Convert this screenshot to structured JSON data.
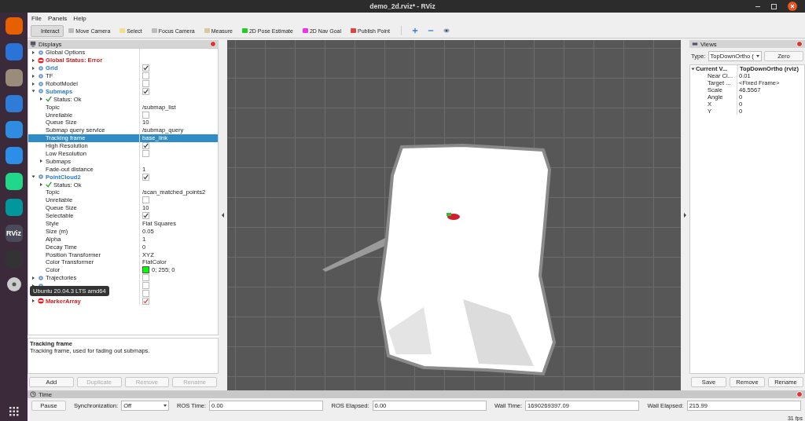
{
  "window": {
    "title": "demo_2d.rviz* - RViz"
  },
  "dock": {
    "logo_text": "RViz"
  },
  "menu": [
    "File",
    "Panels",
    "Help"
  ],
  "tools": [
    {
      "label": "Interact",
      "selected": true
    },
    {
      "label": "Move Camera",
      "selected": false
    },
    {
      "label": "Select",
      "selected": false
    },
    {
      "label": "Focus Camera",
      "selected": false
    },
    {
      "label": "Measure",
      "selected": false
    },
    {
      "label": "2D Pose Estimate",
      "selected": false
    },
    {
      "label": "2D Nav Goal",
      "selected": false
    },
    {
      "label": "Publish Point",
      "selected": false
    }
  ],
  "displays": {
    "title": "Displays",
    "items": [
      {
        "kind": "plain",
        "label": "Global Options",
        "expanded": false,
        "selected": false
      },
      {
        "kind": "error",
        "label": "Global Status: Error",
        "expanded": false,
        "selected": false
      },
      {
        "kind": "display",
        "label": "Grid",
        "checked": true,
        "expanded": false,
        "selected": false
      },
      {
        "kind": "display",
        "label": "TF",
        "checked": false,
        "expanded": false,
        "selected": false
      },
      {
        "kind": "display",
        "label": "RobotModel",
        "checked": false,
        "expanded": false,
        "selected": false
      },
      {
        "kind": "display",
        "label": "Submaps",
        "checked": true,
        "expanded": true,
        "selected": false,
        "children": [
          {
            "kind": "status",
            "label": "Status: Ok",
            "expanded": false,
            "selected": false
          },
          {
            "kind": "property",
            "label": "Topic",
            "value": "/submap_list",
            "selected": false
          },
          {
            "kind": "property",
            "label": "Unreliable",
            "checked": false,
            "selected": false
          },
          {
            "kind": "property",
            "label": "Queue Size",
            "value": "10",
            "selected": false
          },
          {
            "kind": "property",
            "label": "Submap query service",
            "value": "/submap_query",
            "selected": false
          },
          {
            "kind": "property",
            "label": "Tracking frame",
            "value": "base_link",
            "selected": true
          },
          {
            "kind": "property",
            "label": "High Resolution",
            "checked": true,
            "selected": false
          },
          {
            "kind": "property",
            "label": "Low Resolution",
            "checked": false,
            "selected": false
          },
          {
            "kind": "property",
            "label": "Submaps",
            "expanded": false,
            "selected": false
          },
          {
            "kind": "property",
            "label": "Fade-out distance",
            "value": "1",
            "selected": false
          }
        ]
      },
      {
        "kind": "display",
        "label": "PointCloud2",
        "checked": true,
        "expanded": true,
        "selected": false,
        "children": [
          {
            "kind": "status",
            "label": "Status: Ok",
            "expanded": false,
            "selected": false
          },
          {
            "kind": "property",
            "label": "Topic",
            "value": "/scan_matched_points2",
            "selected": false
          },
          {
            "kind": "property",
            "label": "Unreliable",
            "checked": false,
            "selected": false
          },
          {
            "kind": "property",
            "label": "Queue Size",
            "value": "10",
            "selected": false
          },
          {
            "kind": "property",
            "label": "Selectable",
            "checked": true,
            "selected": false
          },
          {
            "kind": "property",
            "label": "Style",
            "value": "Flat Squares",
            "selected": false
          },
          {
            "kind": "property",
            "label": "Size (m)",
            "value": "0.05",
            "selected": false
          },
          {
            "kind": "property",
            "label": "Alpha",
            "value": "1",
            "selected": false
          },
          {
            "kind": "property",
            "label": "Decay Time",
            "value": "0",
            "selected": false
          },
          {
            "kind": "property",
            "label": "Position Transformer",
            "value": "XYZ",
            "selected": false
          },
          {
            "kind": "property",
            "label": "Color Transformer",
            "value": "FlatColor",
            "selected": false
          },
          {
            "kind": "property",
            "label": "Color",
            "value": "0; 255; 0",
            "color": "#00ff00",
            "selected": false
          }
        ]
      },
      {
        "kind": "display",
        "label": "Trajectories",
        "checked": false,
        "expanded": false,
        "selected": false
      },
      {
        "kind": "display",
        "checked": false,
        "expanded": false,
        "selected": false
      },
      {
        "kind": "display",
        "checked": false,
        "selected": false
      },
      {
        "kind": "error",
        "label": "MarkerArray",
        "checked": true,
        "expanded": false,
        "selected": false
      }
    ],
    "tooltip": "Ubuntu 20.04.3 LTS amd64",
    "description": {
      "title": "Tracking frame",
      "text": "Tracking frame, used for fading out submaps."
    },
    "buttons": [
      {
        "label": "Add",
        "disabled": false
      },
      {
        "label": "Duplicate",
        "disabled": true
      },
      {
        "label": "Remove",
        "disabled": true
      },
      {
        "label": "Rename",
        "disabled": true
      }
    ]
  },
  "views": {
    "title": "Views",
    "type_label": "Type:",
    "type_value": "TopDownOrtho (",
    "zero_button": "Zero",
    "current": {
      "label": "Current V...",
      "value": "TopDownOrtho (rviz)",
      "expanded": true
    },
    "properties": [
      {
        "label": "Near Cl...",
        "value": "0.01"
      },
      {
        "label": "Target ...",
        "value": "<Fixed Frame>"
      },
      {
        "label": "Scale",
        "value": "46.5567"
      },
      {
        "label": "Angle",
        "value": "0"
      },
      {
        "label": "X",
        "value": "0"
      },
      {
        "label": "Y",
        "value": "0"
      }
    ],
    "buttons": [
      "Save",
      "Remove",
      "Rename"
    ]
  },
  "time": {
    "title": "Time",
    "pause_button": "Pause",
    "sync_label": "Synchronization:",
    "sync_value": "Off",
    "fields": [
      {
        "label": "ROS Time:",
        "value": "0.00"
      },
      {
        "label": "ROS Elapsed:",
        "value": "0.00"
      },
      {
        "label": "Wall Time:",
        "value": "1690269397.09"
      },
      {
        "label": "Wall Elapsed:",
        "value": "215.99"
      }
    ],
    "fps": "31 fps"
  }
}
